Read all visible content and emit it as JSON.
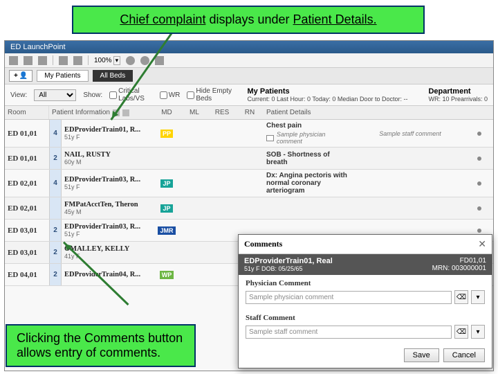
{
  "callouts": {
    "top_pre": "Chief complaint",
    "top_mid": " displays under ",
    "top_post": "Patient Details.",
    "bottom": "Clicking the Comments button allows entry of comments."
  },
  "app": {
    "title": "ED LaunchPoint",
    "zoom": "100%"
  },
  "tabs": {
    "add_label": "+",
    "t1": "My Patients",
    "t2": "All Beds"
  },
  "filter": {
    "view_label": "View:",
    "view_value": "All",
    "show_label": "Show:",
    "chk1": "Critical Labs/VS",
    "chk2": "WR",
    "chk3": "Hide Empty Beds",
    "stats_patients_h": "My Patients",
    "stats_patients_v": "Current: 0   Last Hour: 0   Today: 0   Median Door to Doctor: --",
    "stats_dept_h": "Department",
    "stats_dept_v": "WR: 10   Prearrivals: 0"
  },
  "cols": {
    "room": "Room",
    "pi": "Patient Information",
    "md": "MD",
    "ml": "ML",
    "res": "RES",
    "rn": "RN",
    "det": "Patient Details"
  },
  "rows": [
    {
      "room": "ED 01,01",
      "acu": "4",
      "name": "EDProviderTrain01, R...",
      "sub": "51y F",
      "badge": "PP",
      "bclass": "b-yel",
      "detail": "Chest pain",
      "phys_cmt": "Sample physician comment",
      "staff_cmt": "Sample staff comment"
    },
    {
      "room": "ED 01,01",
      "acu": "2",
      "name": "NAIL, RUSTY",
      "sub": "60y M",
      "badge": "",
      "bclass": "",
      "detail": "SOB - Shortness of breath",
      "phys_cmt": "",
      "staff_cmt": ""
    },
    {
      "room": "ED 02,01",
      "acu": "4",
      "name": "EDProviderTrain03, R...",
      "sub": "51y F",
      "badge": "JP",
      "bclass": "b-teal",
      "detail": "Dx: Angina pectoris with normal coronary arteriogram",
      "phys_cmt": "",
      "staff_cmt": ""
    },
    {
      "room": "ED 02,01",
      "acu": "",
      "name": "FMPatAcctTen, Theron",
      "sub": "45y M",
      "badge": "JP",
      "bclass": "b-teal",
      "detail": "",
      "phys_cmt": "",
      "staff_cmt": ""
    },
    {
      "room": "ED 03,01",
      "acu": "2",
      "name": "EDProviderTrain03, R...",
      "sub": "51y F",
      "badge": "JMR",
      "bclass": "b-blue",
      "detail": "",
      "phys_cmt": "",
      "staff_cmt": ""
    },
    {
      "room": "ED 03,01",
      "acu": "2",
      "name": "OMALLEY, KELLY",
      "sub": "41y F",
      "badge": "",
      "bclass": "",
      "detail": "",
      "phys_cmt": "",
      "staff_cmt": ""
    },
    {
      "room": "ED 04,01",
      "acu": "2",
      "name": "EDProviderTrain04, R...",
      "sub": "",
      "badge": "WP",
      "bclass": "b-grn",
      "detail": "",
      "phys_cmt": "",
      "staff_cmt": ""
    }
  ],
  "popup": {
    "title": "Comments",
    "close": "✕",
    "pname": "EDProviderTrain01, Real",
    "pdemo": "51y   F   DOB: 05/25/65",
    "proom": "FD01,01",
    "pmrn": "MRN: 003000001",
    "sect1": "Physician Comment",
    "val1": "Sample physician comment",
    "sect2": "Staff Comment",
    "val2": "Sample staff comment",
    "eraser": "⌫",
    "dd": "▾",
    "save": "Save",
    "cancel": "Cancel"
  }
}
